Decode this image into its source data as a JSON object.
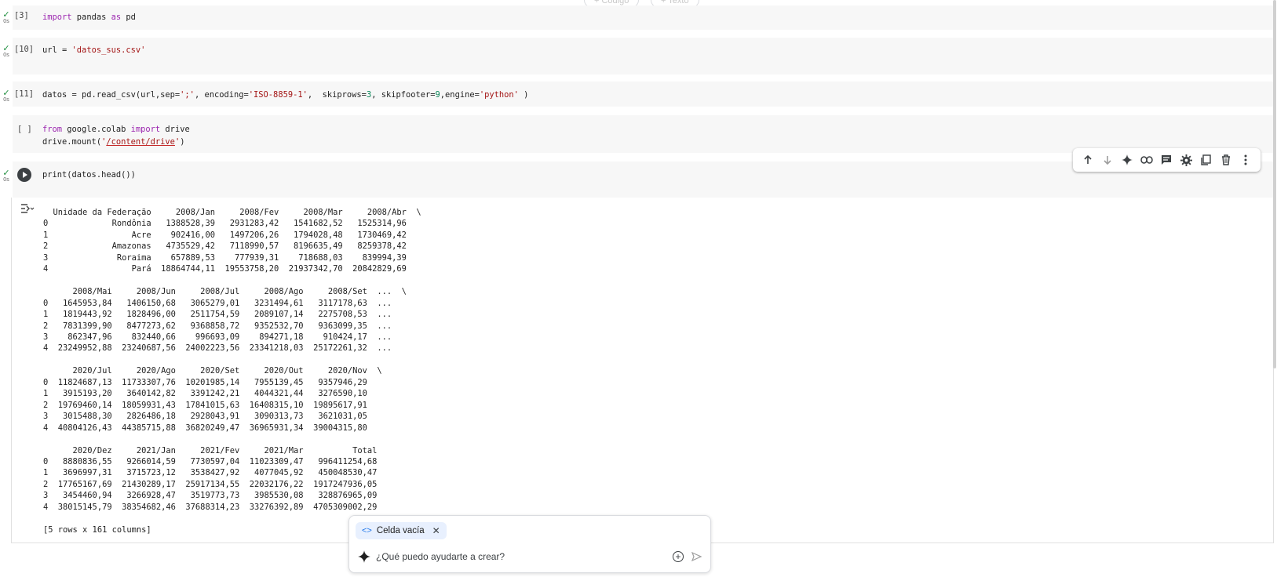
{
  "top_buttons": {
    "code": "+ Código",
    "text": "+ Texto"
  },
  "cells": [
    {
      "count": "[3]",
      "status": "✓",
      "time": "0s"
    },
    {
      "count": "[10]",
      "status": "✓",
      "time": "0s"
    },
    {
      "count": "[11]",
      "status": "✓",
      "time": "0s"
    },
    {
      "count": "[ ]",
      "status": "",
      "time": ""
    },
    {
      "count": "",
      "status": "✓",
      "time": "0s"
    }
  ],
  "code": {
    "c1": {
      "kw1": "import",
      "mid": " pandas ",
      "kw2": "as",
      "end": " pd"
    },
    "c2": {
      "pre": "url = ",
      "str": "'datos_sus.csv'"
    },
    "c3": {
      "a": "datos = pd.read_csv(url,sep=",
      "s1": "';'",
      "b": ", encoding=",
      "s2": "'ISO-8859-1'",
      "c": ",  skiprows=",
      "n1": "3",
      "d": ", skipfooter=",
      "n2": "9",
      "e": ",engine=",
      "s3": "'python'",
      "f": " )"
    },
    "c4": {
      "kw1": "from",
      "mid": " google.colab ",
      "kw2": "import",
      "end": " drive",
      "l2a": "drive.mount(",
      "q1": "'",
      "path": "/content/drive",
      "q2": "'",
      "l2b": ")"
    },
    "c5": {
      "text": "print(datos.head())"
    }
  },
  "output": "  Unidade da Federação     2008/Jan     2008/Fev     2008/Mar     2008/Abr  \\\n0             Rondônia   1388528,39   2931283,42   1541682,52   1525314,96\n1                 Acre    902416,00   1497206,26   1794028,48   1730469,42\n2             Amazonas   4735529,42   7118990,57   8196635,49   8259378,42\n3              Roraima    657889,53    777939,31    718688,03    839994,39\n4                 Pará  18864744,11  19553758,20  21937342,70  20842829,69\n\n      2008/Mai     2008/Jun     2008/Jul     2008/Ago     2008/Set  ...  \\\n0   1645953,84   1406150,68   3065279,01   3231494,61   3117178,63  ...\n1   1819443,92   1828496,00   2511754,59   2089107,14   2275708,53  ...\n2   7831399,90   8477273,62   9368858,72   9352532,70   9363099,35  ...\n3    862347,96    832440,66    996693,09    894271,18    910424,17  ...\n4  23249952,88  23240687,56  24002223,56  23341218,03  25172261,32  ...\n\n      2020/Jul     2020/Ago     2020/Set     2020/Out     2020/Nov  \\\n0  11824687,13  11733307,76  10201985,14   7955139,45   9357946,29\n1   3915193,20   3640142,82   3391242,21   4044321,44   3276590,10\n2  19769460,14  18059931,43  17841015,63  16408315,10  19895617,91\n3   3015488,30   2826486,18   2928043,91   3090313,73   3621031,05\n4  40804126,43  44385715,88  36820249,47  36965931,34  39004315,80\n\n      2020/Dez     2021/Jan     2021/Fev     2021/Mar          Total\n0   8880836,55   9266014,59   7730597,04  11023309,47   996411254,68\n1   3696997,31   3715723,12   3538427,92   4077045,92   450048530,47\n2  17765167,69  21430289,17  25917134,55  22032176,22  1917247936,05\n3   3454460,94   3266928,47   3519773,73   3985530,08   328876965,09\n4  38015145,79  38354682,46  37688314,23  33276392,89  4705309002,29\n\n[5 rows x 161 columns]",
  "ai_panel": {
    "chip_label": "Celda vacía",
    "placeholder": "¿Qué puedo ayudarte a crear?"
  }
}
